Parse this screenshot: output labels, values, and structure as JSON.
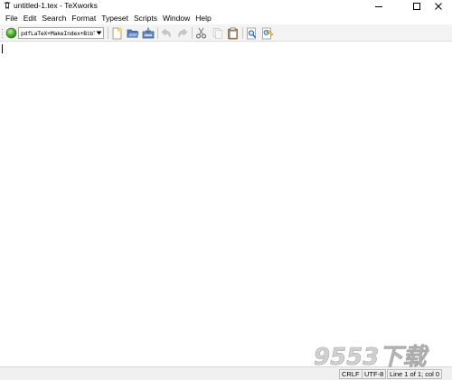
{
  "window": {
    "title": "untitled-1.tex - TeXworks",
    "controls": {
      "minimize": "minimize",
      "maximize": "maximize",
      "close": "close"
    }
  },
  "menu": {
    "items": [
      "File",
      "Edit",
      "Search",
      "Format",
      "Typeset",
      "Scripts",
      "Window",
      "Help"
    ]
  },
  "toolbar": {
    "typeset_engine": "pdfLaTeX+MakeIndex+BibTeX",
    "icons": [
      "typeset-icon",
      "new-document-icon",
      "open-folder-icon",
      "save-icon",
      "undo-icon",
      "redo-icon",
      "cut-icon",
      "copy-icon",
      "paste-icon",
      "find-icon",
      "replace-icon"
    ]
  },
  "editor": {
    "content": ""
  },
  "statusbar": {
    "line_ending": "CRLF",
    "encoding": "UTF-8",
    "position": "Line 1 of 1; col 0"
  },
  "watermark": {
    "text": "9553下载"
  },
  "colors": {
    "typeset_green": "#4caf2e",
    "toolbar_bg": "#f3f3f3",
    "statusbar_bg": "#f0f0f0",
    "watermark": "#c9c9c9"
  }
}
